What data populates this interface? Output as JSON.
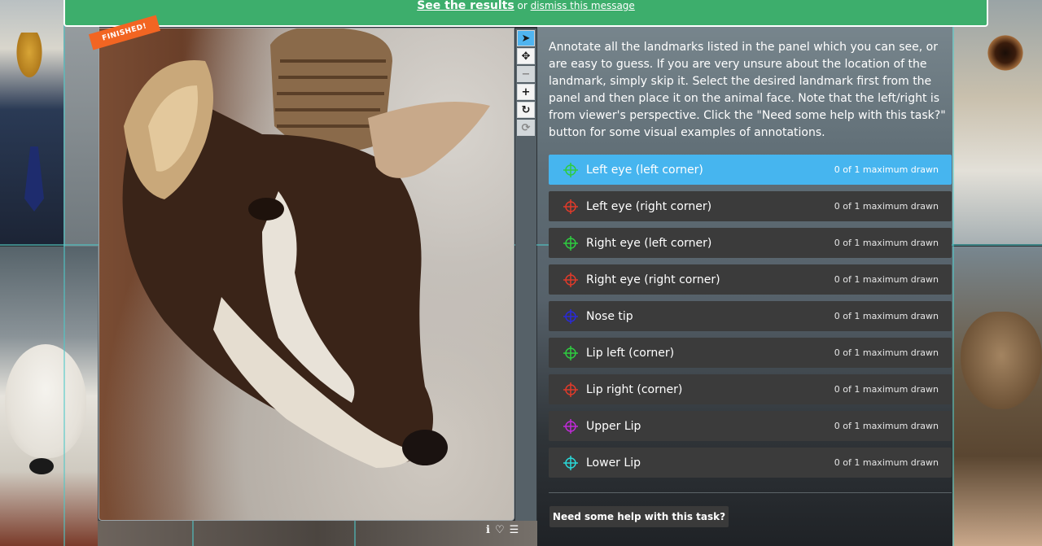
{
  "banner": {
    "results_link": "See the results",
    "connector": "or",
    "dismiss_link": "dismiss this message"
  },
  "image_panel": {
    "finished_badge": "FINISHED!",
    "toolbar": [
      {
        "icon": "pointer-icon",
        "glyph": "➤",
        "state": "active"
      },
      {
        "icon": "move-icon",
        "glyph": "✥",
        "state": "normal"
      },
      {
        "icon": "zoom-out-icon",
        "glyph": "−",
        "state": "disabled"
      },
      {
        "icon": "zoom-in-icon",
        "glyph": "+",
        "state": "normal"
      },
      {
        "icon": "rotate-icon",
        "glyph": "↻",
        "state": "normal"
      },
      {
        "icon": "reset-icon",
        "glyph": "⟳",
        "state": "disabled"
      }
    ],
    "bottom_icons": {
      "info": "ℹ",
      "favorite": "♡",
      "collections": "☰"
    }
  },
  "instructions": "Annotate all the landmarks listed in the panel which you can see, or are easy to guess. If you are very unsure about the location of the landmark, simply skip it. Select the desired landmark first from the panel and then place it on the animal face. Note that the left/right is from viewer's perspective. Click the \"Need some help with this task?\" button for some visual examples of annotations.",
  "landmarks": [
    {
      "label": "Left eye (left corner)",
      "count": "0 of 1 maximum drawn",
      "color": "#2ecc40",
      "selected": true
    },
    {
      "label": "Left eye (right corner)",
      "count": "0 of 1 maximum drawn",
      "color": "#e03a2a",
      "selected": false
    },
    {
      "label": "Right eye (left corner)",
      "count": "0 of 1 maximum drawn",
      "color": "#2ecc40",
      "selected": false
    },
    {
      "label": "Right eye (right corner)",
      "count": "0 of 1 maximum drawn",
      "color": "#e03a2a",
      "selected": false
    },
    {
      "label": "Nose tip",
      "count": "0 of 1 maximum drawn",
      "color": "#2a2ad8",
      "selected": false
    },
    {
      "label": "Lip left (corner)",
      "count": "0 of 1 maximum drawn",
      "color": "#2ecc40",
      "selected": false
    },
    {
      "label": "Lip right (corner)",
      "count": "0 of 1 maximum drawn",
      "color": "#e03a2a",
      "selected": false
    },
    {
      "label": "Upper Lip",
      "count": "0 of 1 maximum drawn",
      "color": "#c02ad8",
      "selected": false
    },
    {
      "label": "Lower Lip",
      "count": "0 of 1 maximum drawn",
      "color": "#2ad8d8",
      "selected": false
    }
  ],
  "help_button": "Need some help with this task?"
}
